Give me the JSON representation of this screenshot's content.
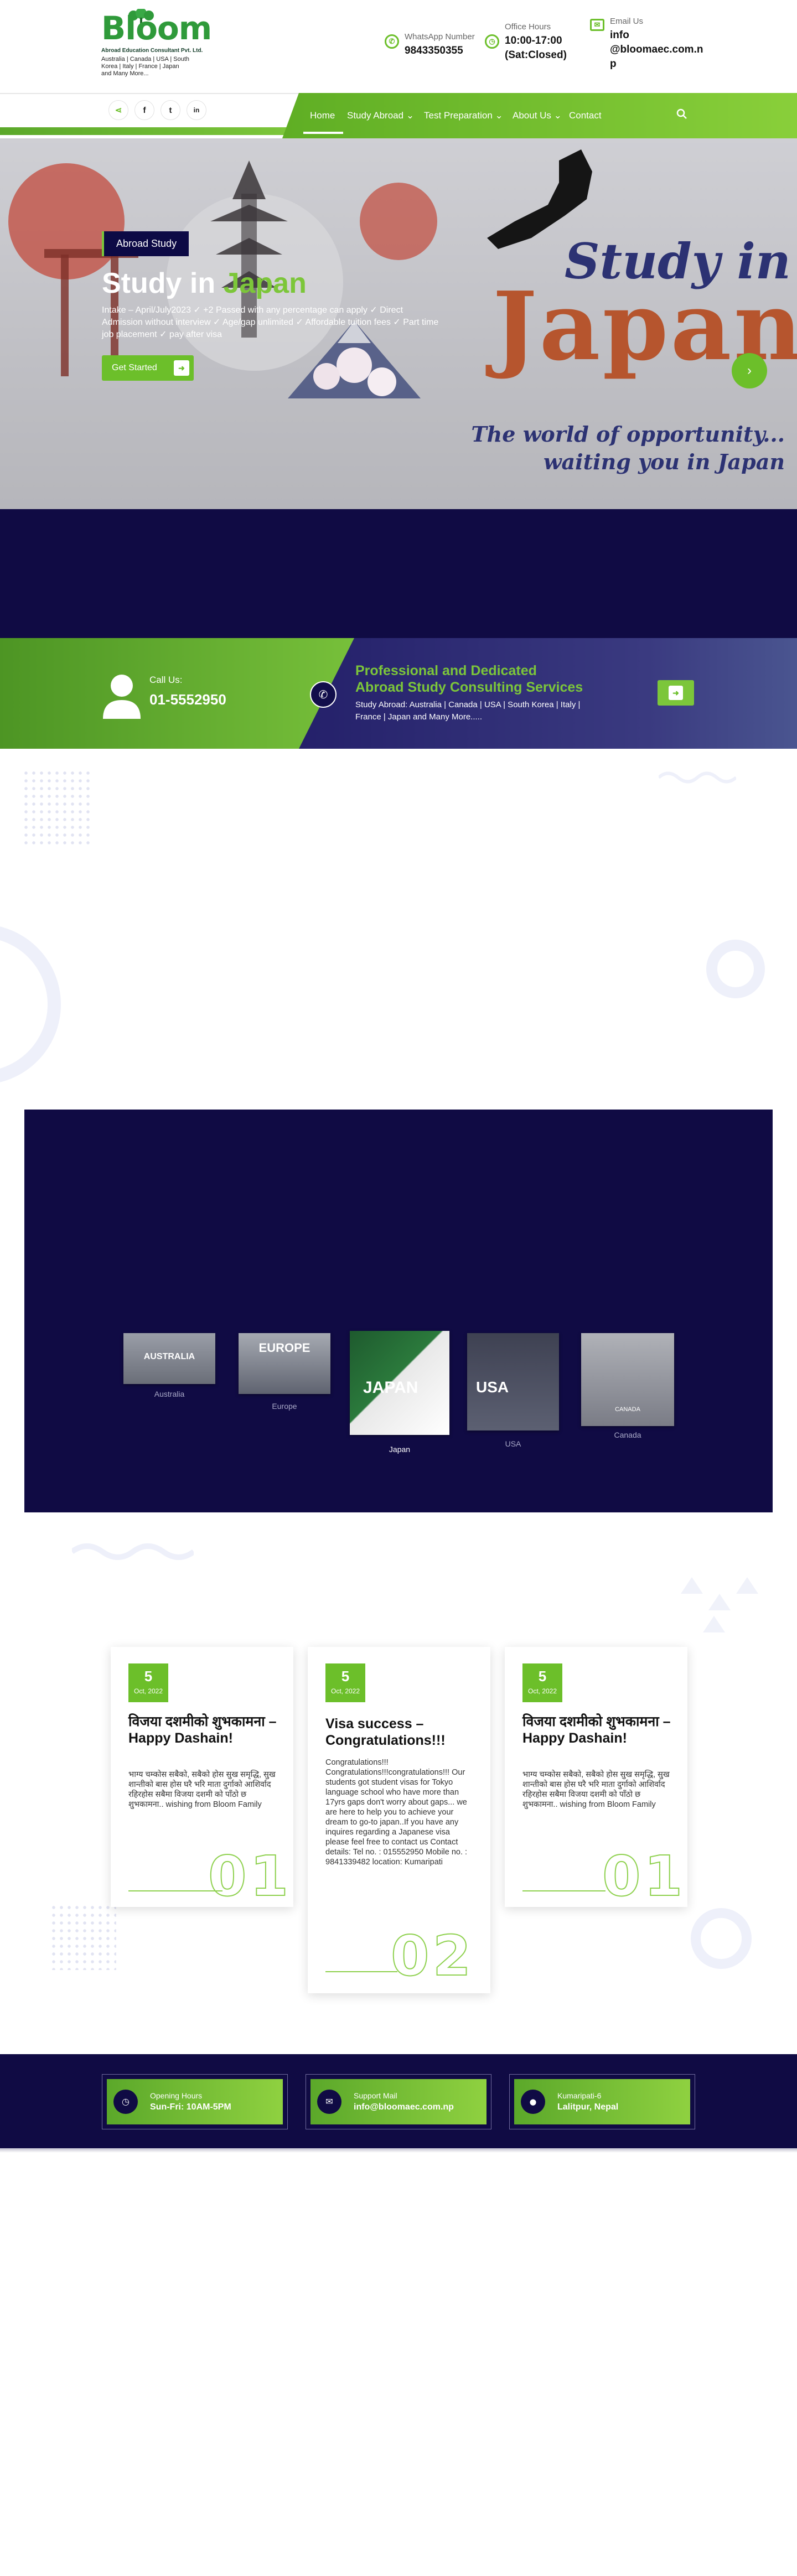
{
  "header": {
    "logo_word": "Bloom",
    "logo_sub": "Abroad Education Consultant Pvt. Ltd.",
    "logo_countries": "Australia | Canada | USA | South Korea | Italy | France | Japan and Many More...",
    "whatsapp": {
      "label": "WhatsApp Number",
      "value": "9843350355"
    },
    "office": {
      "label": "Office Hours",
      "value_line1": "10:00-17:00",
      "value_line2": "(Sat:Closed)"
    },
    "email": {
      "label": "Email Us",
      "value_line1": "info",
      "value_line2": "@bloomaec.com.n",
      "value_line3": "p"
    }
  },
  "nav": {
    "social": [
      "share-icon",
      "facebook-icon",
      "twitter-icon",
      "linkedin-icon"
    ],
    "social_glyphs": [
      "⋖",
      "f",
      "t",
      "in"
    ],
    "items": [
      "Home",
      "Study Abroad",
      "Test Preparation",
      "About Us",
      "Contact"
    ],
    "active": "Home"
  },
  "hero": {
    "tag": "Abroad Study",
    "title_prefix": "Study in",
    "title_accent": "Japan",
    "description": "Intake – April/July2023 ✓ +2 Passed with any percentage can apply ✓ Direct Admission without interview ✓ Age/gap unlimited ✓ Affordable tuition fees ✓ Part time job placement ✓ pay after visa",
    "button": "Get Started",
    "next_button": "›",
    "banner_study_in": "Study in",
    "banner_japan": "Japan",
    "banner_tagline_1": "The world of opportunity...",
    "banner_tagline_2": "waiting you in Japan"
  },
  "call_strip": {
    "call_label": "Call Us:",
    "call_number": "01-5552950",
    "heading_line1": "Professional and Dedicated",
    "heading_line2": "Abroad Study Consulting Services",
    "text": "Study Abroad: Australia | Canada | USA | South Korea | Italy | France | Japan and Many More....."
  },
  "destinations": [
    {
      "label": "Australia",
      "card_text": "AUSTRALIA"
    },
    {
      "label": "Europe",
      "card_text": "EUROPE"
    },
    {
      "label": "Japan",
      "card_text": "JAPAN"
    },
    {
      "label": "USA",
      "card_text": "USA"
    },
    {
      "label": "Canada",
      "card_text": "CANADA"
    }
  ],
  "blog": [
    {
      "day": "5",
      "month": "Oct, 2022",
      "title": "विजया दशमीको शुभकामना – Happy Dashain!",
      "body": "भाग्य चम्कोस सबैको, सबैको होस सुख समृद्धि, सुख शान्तीको बास होस घरै भरि माता दुर्गाको आशिर्वाद रहिरहोस सबैमा विजया दशमी को पाँठो छ शुभकामना.. wishing from Bloom Family",
      "number": "01"
    },
    {
      "day": "5",
      "month": "Oct, 2022",
      "title": "Visa success – Congratulations!!!",
      "body": "Congratulations!!! Congratulations!!!congratulations!!! Our students got student visas for Tokyo language school who have more than 17yrs gaps don't worry about gaps... we are here to help you to achieve your dream to go-to japan..If you have any inquires regarding a Japanese visa please feel free to contact us Contact details: Tel no. : 015552950 Mobile no. : 9841339482 location: Kumaripati",
      "number": "02"
    },
    {
      "day": "5",
      "month": "Oct, 2022",
      "title": "विजया दशमीको शुभकामना – Happy Dashain!",
      "body": "भाग्य चम्कोस सबैको, सबैको होस सुख समृद्धि, सुख शान्तीको बास होस घरै भरि माता दुर्गाको आशिर्वाद रहिरहोस सबैमा विजया दशमी को पाँठो छ शुभकामना.. wishing from Bloom Family",
      "number": "01"
    }
  ],
  "contact_band": [
    {
      "icon": "clock-icon",
      "glyph": "◷",
      "label": "Opening Hours",
      "value": "Sun-Fri: 10AM-5PM"
    },
    {
      "icon": "mail-icon",
      "glyph": "✉",
      "label": "Support Mail",
      "value": "info@bloomaec.com.np"
    },
    {
      "icon": "location-icon",
      "glyph": "⬤",
      "label": "Kumaripati-6",
      "value": "Lalitpur, Nepal"
    }
  ],
  "colors": {
    "brand_green": "#6cbf2a",
    "navy": "#100b44",
    "logo_green": "#2f9a3a"
  }
}
